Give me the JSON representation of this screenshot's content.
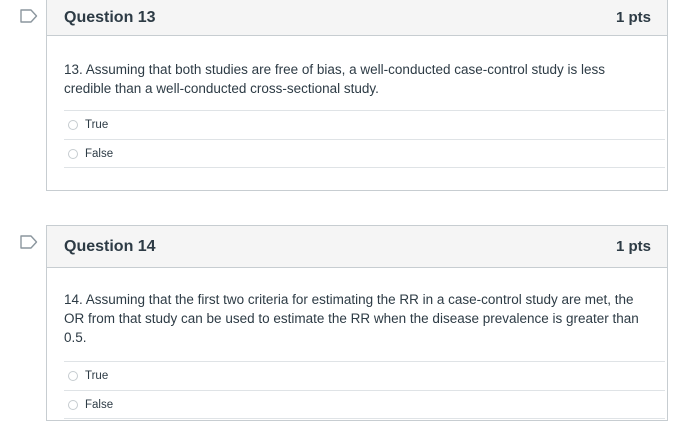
{
  "questions": [
    {
      "title": "Question 13",
      "points": "1 pts",
      "text": "13. Assuming that both studies are free of bias, a well-conducted case-control study is less credible than a well-conducted cross-sectional study.",
      "answers": [
        "True",
        "False"
      ]
    },
    {
      "title": "Question 14",
      "points": "1 pts",
      "text": "14. Assuming that the first two criteria for estimating the RR in a case-control study are met, the OR from that study can be used to estimate the RR when the disease prevalence is greater than 0.5.",
      "answers": [
        "True",
        "False"
      ]
    }
  ],
  "colors": {
    "header_bg": "#f5f5f5",
    "border": "#c7cdd1",
    "text": "#2d3b45",
    "flag_outline": "#8b969e"
  },
  "icons": {
    "flag": "bookmark-flag-icon",
    "radio": "radio-unselected-icon"
  }
}
